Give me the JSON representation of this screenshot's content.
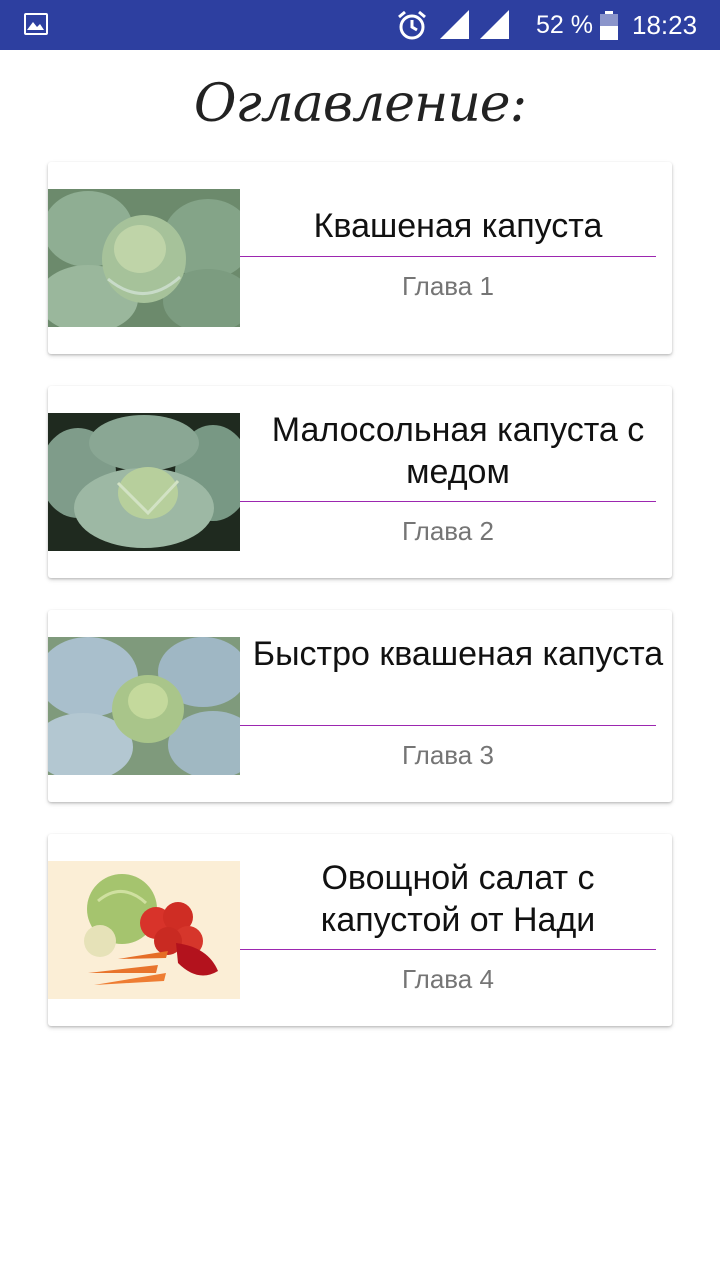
{
  "status_bar": {
    "battery": "52 %",
    "time": "18:23",
    "icons": [
      "gallery-icon",
      "alarm-icon",
      "signal-icon",
      "signal-icon",
      "battery-icon"
    ]
  },
  "header": {
    "title": "Оглавление:"
  },
  "chapters": [
    {
      "title": "Квашеная капуста",
      "chapter": "Глава 1",
      "image": "cabbage-photo"
    },
    {
      "title": "Малосольная капуста с медом",
      "chapter": "Глава 2",
      "image": "cabbage-photo"
    },
    {
      "title": "Быстро квашеная капуста",
      "chapter": "Глава 3",
      "image": "cabbage-photo"
    },
    {
      "title": "Овощной салат с капустой от Нади",
      "chapter": "Глава 4",
      "image": "vegetables-photo"
    }
  ],
  "colors": {
    "status_bar": "#2d3fa0",
    "divider": "#9c27b0",
    "chapter_text": "#757575",
    "title_text": "#111111"
  }
}
